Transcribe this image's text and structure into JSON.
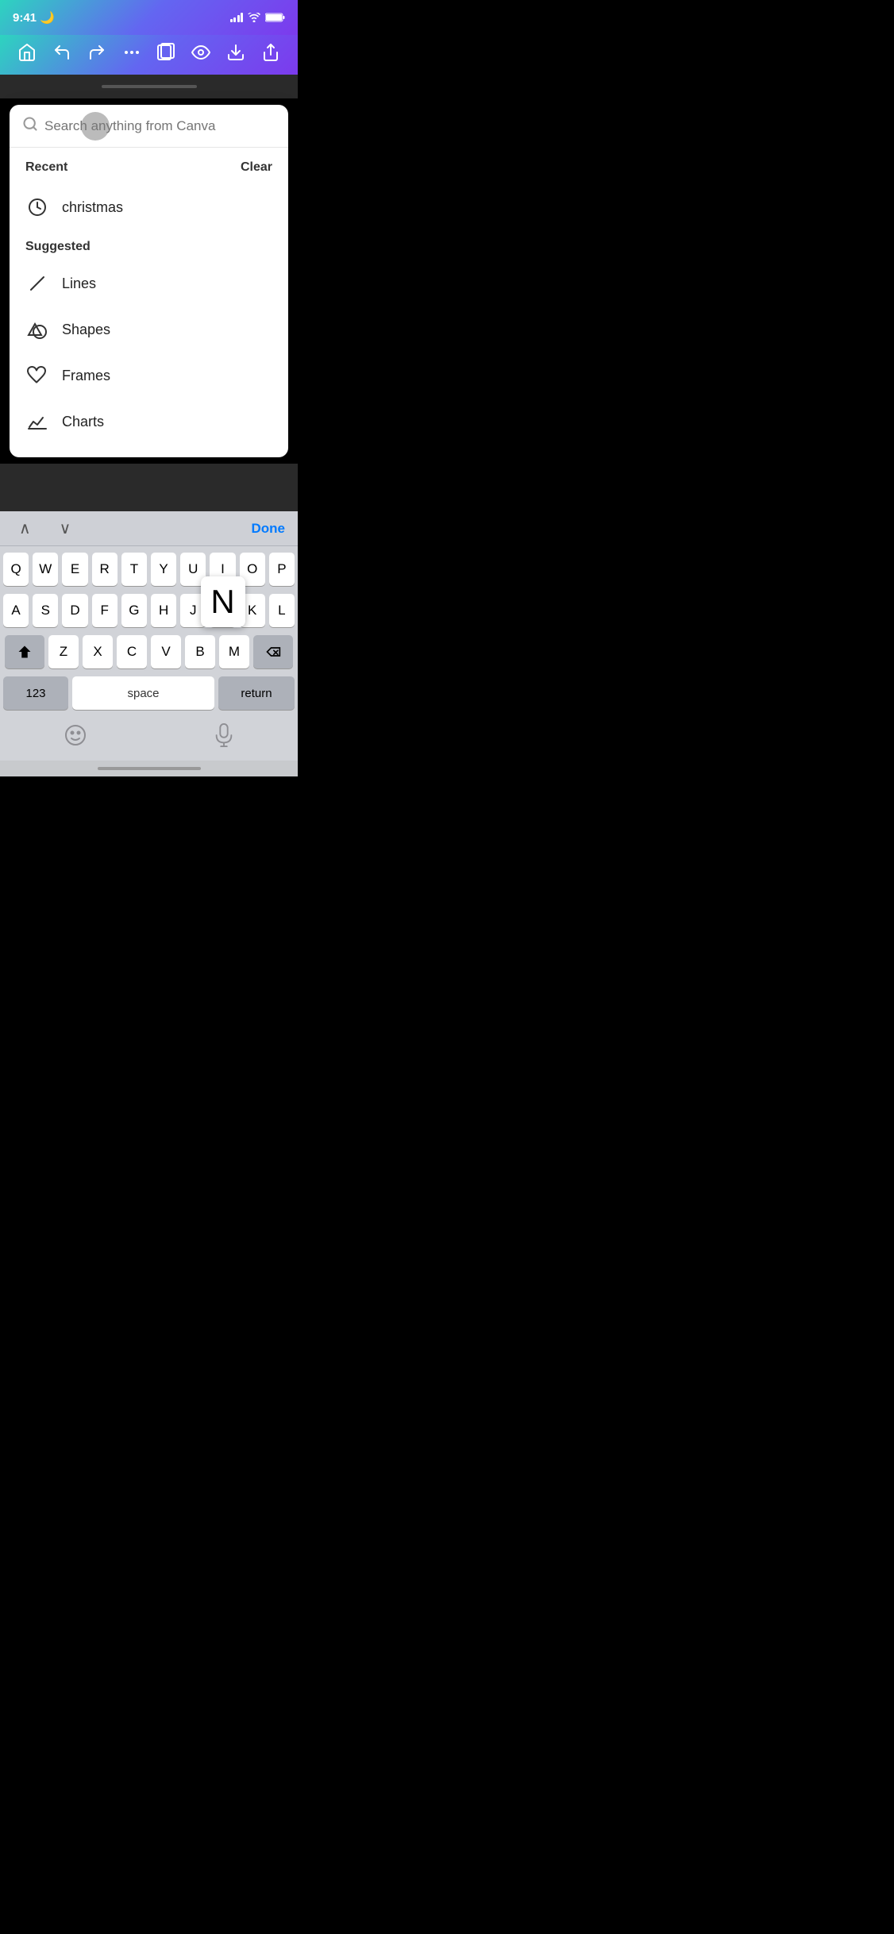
{
  "statusBar": {
    "time": "9:41",
    "moonIcon": "🌙"
  },
  "toolbar": {
    "icons": [
      "home",
      "undo",
      "redo",
      "more",
      "pages",
      "preview",
      "download",
      "share"
    ]
  },
  "search": {
    "placeholder": "Search anything from Canva",
    "inputValue": ""
  },
  "recent": {
    "sectionTitle": "Recent",
    "clearLabel": "Clear",
    "items": [
      {
        "label": "christmas",
        "iconType": "clock"
      }
    ]
  },
  "suggested": {
    "sectionTitle": "Suggested",
    "items": [
      {
        "label": "Lines",
        "iconType": "line"
      },
      {
        "label": "Shapes",
        "iconType": "shapes"
      },
      {
        "label": "Frames",
        "iconType": "frames"
      },
      {
        "label": "Charts",
        "iconType": "charts"
      }
    ]
  },
  "keyboard": {
    "doneLabel": "Done",
    "spaceLabel": "space",
    "returnLabel": "return",
    "numsLabel": "123",
    "rows": [
      [
        "Q",
        "W",
        "E",
        "R",
        "T",
        "Y",
        "U",
        "I",
        "O",
        "P"
      ],
      [
        "A",
        "S",
        "D",
        "F",
        "G",
        "H",
        "J",
        "K",
        "L"
      ],
      [
        "Z",
        "X",
        "C",
        "V",
        "B",
        "N",
        "M"
      ]
    ]
  }
}
